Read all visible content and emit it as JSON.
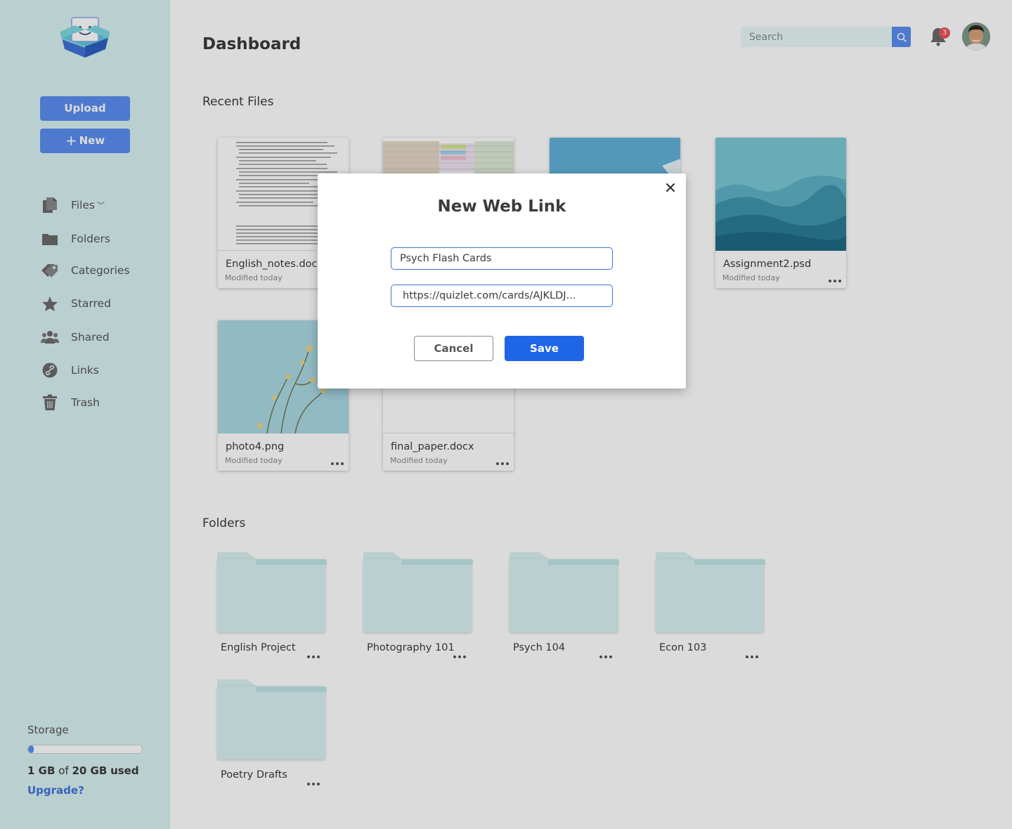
{
  "sidebar": {
    "upload_label": "Upload",
    "new_label": "New",
    "nav": [
      {
        "label": "Files",
        "icon": "files-icon"
      },
      {
        "label": "Folders",
        "icon": "folder-icon"
      },
      {
        "label": "Categories",
        "icon": "tags-icon"
      },
      {
        "label": "Starred",
        "icon": "star-icon"
      },
      {
        "label": "Shared",
        "icon": "users-icon"
      },
      {
        "label": "Links",
        "icon": "link-icon"
      },
      {
        "label": "Trash",
        "icon": "trash-icon"
      }
    ],
    "storage": {
      "label": "Storage",
      "used": "1 GB",
      "of": "of",
      "total": "20 GB",
      "suffix": "used",
      "fraction": 0.05,
      "upgrade": "Upgrade?"
    }
  },
  "header": {
    "title": "Dashboard",
    "search_placeholder": "Search",
    "notification_count": "3"
  },
  "recent": {
    "title": "Recent Files",
    "files": [
      {
        "name": "English_notes.docx",
        "modified": "Modified today",
        "thumb": "document"
      },
      {
        "name": "",
        "modified": "",
        "thumb": "spreadsheet"
      },
      {
        "name": "",
        "modified": "",
        "thumb": "sky-photo"
      },
      {
        "name": "Assignment2.psd",
        "modified": "Modified today",
        "thumb": "mountains"
      },
      {
        "name": "photo4.png",
        "modified": "Modified today",
        "thumb": "flowers"
      },
      {
        "name": "final_paper.docx",
        "modified": "Modified today",
        "thumb": "blank"
      }
    ]
  },
  "folders": {
    "title": "Folders",
    "items": [
      {
        "name": "English Project"
      },
      {
        "name": "Photography 101"
      },
      {
        "name": "Psych 104"
      },
      {
        "name": "Econ 103"
      },
      {
        "name": "Poetry Drafts"
      }
    ]
  },
  "modal": {
    "title": "New Web Link",
    "name_value": "Psych Flash Cards",
    "url_value": "https://quizlet.com/cards/AJKLDJ...",
    "cancel_label": "Cancel",
    "save_label": "Save"
  },
  "colors": {
    "sidebar_bg": "#d9f1f1",
    "accent": "#5a8ef0",
    "save": "#1e66e6",
    "folder": "#d9f1f1",
    "badge": "#e8545a"
  }
}
